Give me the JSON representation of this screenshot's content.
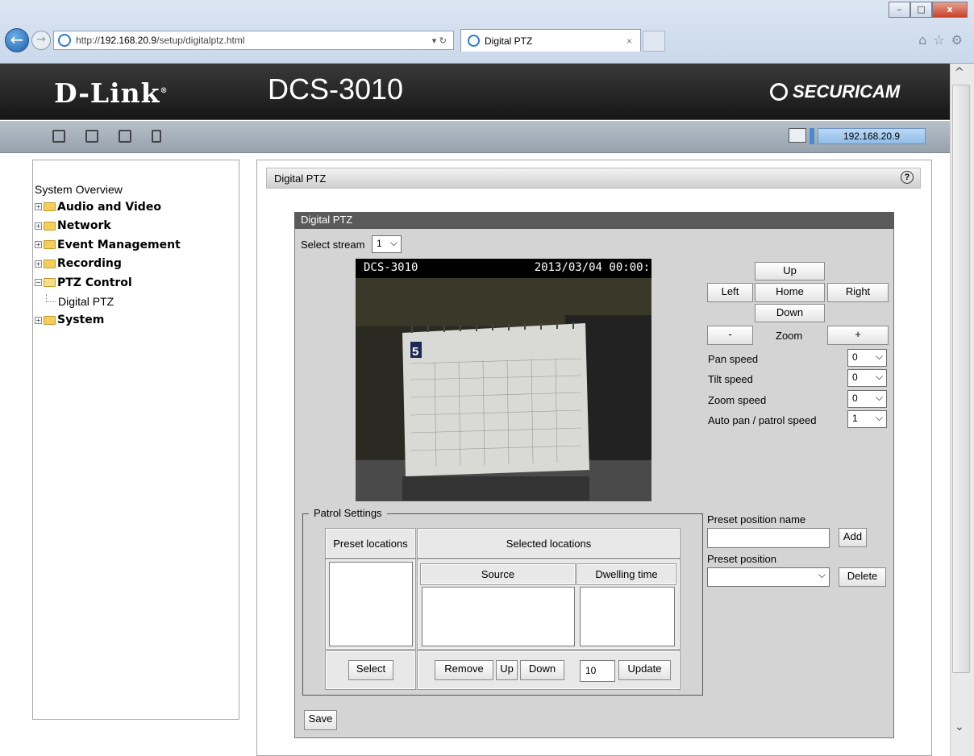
{
  "browser": {
    "url_prefix": "http://",
    "url_host": "192.168.20.9",
    "url_path": "/setup/digitalptz.html",
    "tab_title": "Digital PTZ",
    "window_buttons": [
      "–",
      "□",
      "x"
    ]
  },
  "header": {
    "brand": "D-Link",
    "model": "DCS-3010",
    "product_line": "SECURICAM",
    "ip": "192.168.20.9"
  },
  "sidebar": {
    "top": "System Overview",
    "items": [
      {
        "label": "Audio and Video",
        "open": false
      },
      {
        "label": "Network",
        "open": false
      },
      {
        "label": "Event Management",
        "open": false
      },
      {
        "label": "Recording",
        "open": false
      },
      {
        "label": "PTZ Control",
        "open": true,
        "children": [
          "Digital PTZ"
        ]
      },
      {
        "label": "System",
        "open": false
      }
    ]
  },
  "panel": {
    "title": "Digital PTZ",
    "help": "?",
    "inner_title": "Digital PTZ",
    "select_stream_label": "Select stream",
    "select_stream_value": "1",
    "video": {
      "camera_name": "DCS-3010",
      "timestamp": "2013/03/04 00:00:",
      "calendar_month": "5"
    },
    "ptz": {
      "up": "Up",
      "left": "Left",
      "home": "Home",
      "right": "Right",
      "down": "Down",
      "zoom_out": "-",
      "zoom_label": "Zoom",
      "zoom_in": "+"
    },
    "speeds": [
      {
        "label": "Pan speed",
        "value": "0"
      },
      {
        "label": "Tilt speed",
        "value": "0"
      },
      {
        "label": "Zoom speed",
        "value": "0"
      },
      {
        "label": "Auto pan / patrol speed",
        "value": "1"
      }
    ],
    "preset": {
      "name_label": "Preset position name",
      "name_value": "",
      "add": "Add",
      "position_label": "Preset position",
      "position_value": "",
      "delete": "Delete"
    },
    "patrol": {
      "legend": "Patrol Settings",
      "preset_locations": "Preset locations",
      "selected_locations": "Selected locations",
      "source": "Source",
      "dwelling_time": "Dwelling time",
      "select": "Select",
      "remove": "Remove",
      "up": "Up",
      "down": "Down",
      "dwell_value": "10",
      "update": "Update"
    },
    "save": "Save"
  }
}
